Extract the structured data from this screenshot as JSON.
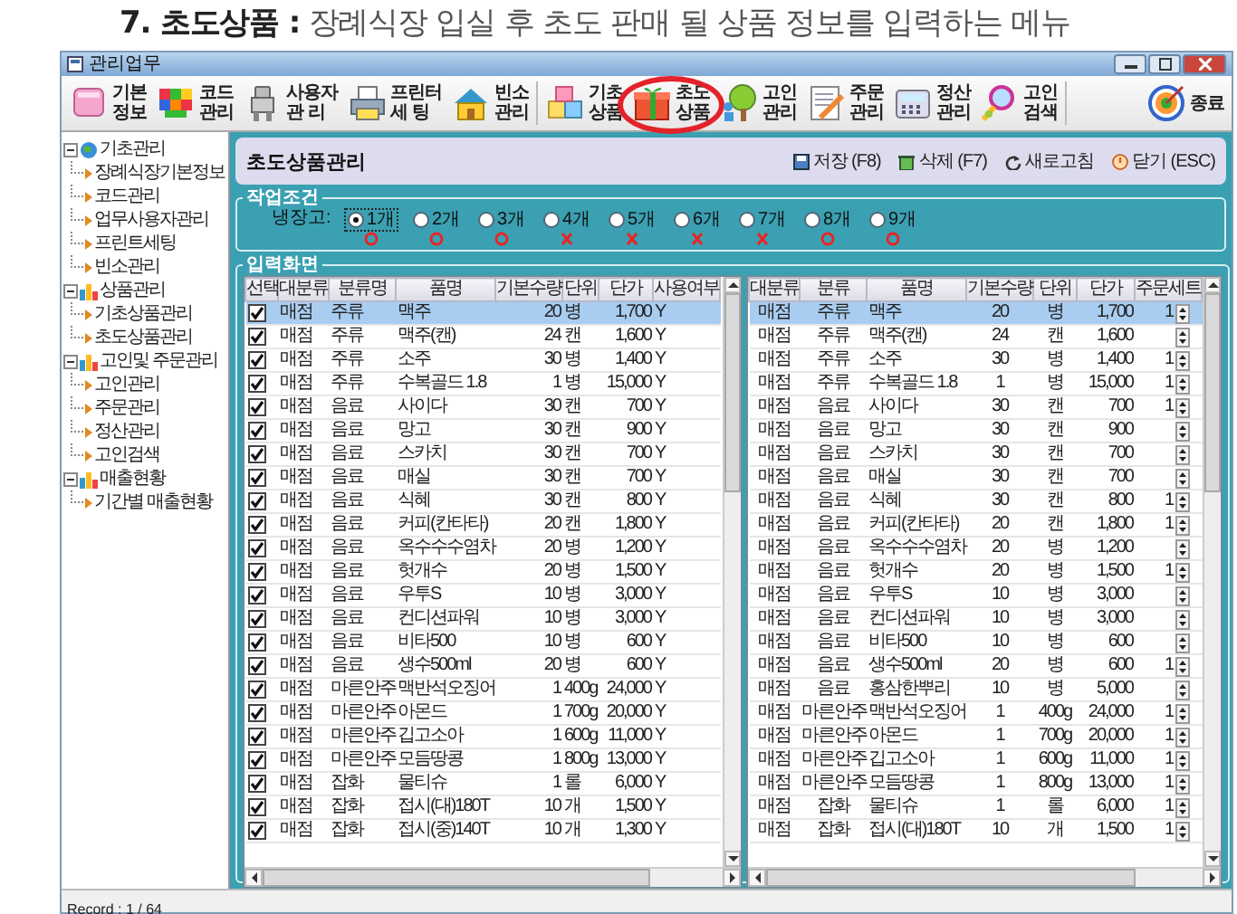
{
  "heading": "**7. 초도상품 :** 장례식장 입실 후 초도 판매 될 상품 정보를 입력하는 메뉴",
  "window": {
    "title": "관리업무"
  },
  "toolbar": [
    {
      "label": "기본\n정보",
      "highlighted": false
    },
    {
      "label": "코드\n관리",
      "highlighted": false
    },
    {
      "label": "사용자\n관 리",
      "highlighted": false
    },
    {
      "label": "프린터\n세 팅",
      "highlighted": false
    },
    {
      "label": "빈소\n관리",
      "highlighted": false
    },
    {
      "label": "기초\n상품",
      "highlighted": false
    },
    {
      "label": "초도\n상품",
      "highlighted": true
    },
    {
      "label": "고인\n관리",
      "highlighted": false
    },
    {
      "label": "주문\n관리",
      "highlighted": false
    },
    {
      "label": "정산\n관리",
      "highlighted": false
    },
    {
      "label": "고인\n검색",
      "highlighted": false
    }
  ],
  "exit_button": "종료",
  "sidebar": {
    "items": [
      {
        "label": "기초관리",
        "expanded": true,
        "children": [
          {
            "label": "장례식장기본정보"
          },
          {
            "label": "코드관리"
          },
          {
            "label": "업무사용자관리"
          },
          {
            "label": "프린트세팅"
          },
          {
            "label": "빈소관리"
          }
        ]
      },
      {
        "label": "상품관리",
        "expanded": true,
        "children": [
          {
            "label": "기초상품관리"
          },
          {
            "label": "초도상품관리"
          }
        ]
      },
      {
        "label": "고인및 주문관리",
        "expanded": true,
        "children": [
          {
            "label": "고인관리"
          },
          {
            "label": "주문관리"
          },
          {
            "label": "정산관리"
          },
          {
            "label": "고인검색"
          }
        ]
      },
      {
        "label": "매출현황",
        "expanded": true,
        "children": [
          {
            "label": "기간별 매출현황"
          }
        ]
      }
    ]
  },
  "panel": {
    "title": "초도상품관리",
    "actions": [
      "저장 (F8)",
      "삭제 (F7)",
      "새로고침",
      "닫기 (ESC)"
    ]
  },
  "conditions": {
    "title": "작업조건",
    "label": "냉장고:",
    "options": [
      {
        "label": "1개",
        "selected": true,
        "available": true
      },
      {
        "label": "2개",
        "selected": false,
        "available": true
      },
      {
        "label": "3개",
        "selected": false,
        "available": true
      },
      {
        "label": "4개",
        "selected": false,
        "available": false
      },
      {
        "label": "5개",
        "selected": false,
        "available": false
      },
      {
        "label": "6개",
        "selected": false,
        "available": false
      },
      {
        "label": "7개",
        "selected": false,
        "available": false
      },
      {
        "label": "8개",
        "selected": false,
        "available": true
      },
      {
        "label": "9개",
        "selected": false,
        "available": true
      }
    ]
  },
  "input": {
    "title": "입력화면",
    "left_table": {
      "columns": [
        "선택",
        "대분류",
        "분류명",
        "품명",
        "기본수량",
        "단위",
        "단가",
        "사용여부"
      ],
      "rows": [
        {
          "selected": true,
          "checked": true,
          "category": "매점",
          "group": "주류",
          "name": "맥주",
          "qty": "20",
          "unit": "병",
          "price": "1,700",
          "use": "Y"
        },
        {
          "selected": false,
          "checked": true,
          "category": "매점",
          "group": "주류",
          "name": "맥주(캔)",
          "qty": "24",
          "unit": "캔",
          "price": "1,600",
          "use": "Y"
        },
        {
          "selected": false,
          "checked": true,
          "category": "매점",
          "group": "주류",
          "name": "소주",
          "qty": "30",
          "unit": "병",
          "price": "1,400",
          "use": "Y"
        },
        {
          "selected": false,
          "checked": true,
          "category": "매점",
          "group": "주류",
          "name": "수복골드 1.8",
          "qty": "1",
          "unit": "병",
          "price": "15,000",
          "use": "Y"
        },
        {
          "selected": false,
          "checked": true,
          "category": "매점",
          "group": "음료",
          "name": "사이다",
          "qty": "30",
          "unit": "캔",
          "price": "700",
          "use": "Y"
        },
        {
          "selected": false,
          "checked": true,
          "category": "매점",
          "group": "음료",
          "name": "망고",
          "qty": "30",
          "unit": "캔",
          "price": "900",
          "use": "Y"
        },
        {
          "selected": false,
          "checked": true,
          "category": "매점",
          "group": "음료",
          "name": "스카치",
          "qty": "30",
          "unit": "캔",
          "price": "700",
          "use": "Y"
        },
        {
          "selected": false,
          "checked": true,
          "category": "매점",
          "group": "음료",
          "name": "매실",
          "qty": "30",
          "unit": "캔",
          "price": "700",
          "use": "Y"
        },
        {
          "selected": false,
          "checked": true,
          "category": "매점",
          "group": "음료",
          "name": "식혜",
          "qty": "30",
          "unit": "캔",
          "price": "800",
          "use": "Y"
        },
        {
          "selected": false,
          "checked": true,
          "category": "매점",
          "group": "음료",
          "name": "커피(칸타타)",
          "qty": "20",
          "unit": "캔",
          "price": "1,800",
          "use": "Y"
        },
        {
          "selected": false,
          "checked": true,
          "category": "매점",
          "group": "음료",
          "name": "옥수수수염차",
          "qty": "20",
          "unit": "병",
          "price": "1,200",
          "use": "Y"
        },
        {
          "selected": false,
          "checked": true,
          "category": "매점",
          "group": "음료",
          "name": "헛개수",
          "qty": "20",
          "unit": "병",
          "price": "1,500",
          "use": "Y"
        },
        {
          "selected": false,
          "checked": true,
          "category": "매점",
          "group": "음료",
          "name": "우투S",
          "qty": "10",
          "unit": "병",
          "price": "3,000",
          "use": "Y"
        },
        {
          "selected": false,
          "checked": true,
          "category": "매점",
          "group": "음료",
          "name": "컨디션파워",
          "qty": "10",
          "unit": "병",
          "price": "3,000",
          "use": "Y"
        },
        {
          "selected": false,
          "checked": true,
          "category": "매점",
          "group": "음료",
          "name": "비타500",
          "qty": "10",
          "unit": "병",
          "price": "600",
          "use": "Y"
        },
        {
          "selected": false,
          "checked": true,
          "category": "매점",
          "group": "음료",
          "name": "생수500ml",
          "qty": "20",
          "unit": "병",
          "price": "600",
          "use": "Y"
        },
        {
          "selected": false,
          "checked": true,
          "category": "매점",
          "group": "마른안주",
          "name": "맥반석오징어",
          "qty": "1",
          "unit": "400g",
          "price": "24,000",
          "use": "Y"
        },
        {
          "selected": false,
          "checked": true,
          "category": "매점",
          "group": "마른안주",
          "name": "아몬드",
          "qty": "1",
          "unit": "700g",
          "price": "20,000",
          "use": "Y"
        },
        {
          "selected": false,
          "checked": true,
          "category": "매점",
          "group": "마른안주",
          "name": "깁고소아",
          "qty": "1",
          "unit": "600g",
          "price": "11,000",
          "use": "Y"
        },
        {
          "selected": false,
          "checked": true,
          "category": "매점",
          "group": "마른안주",
          "name": "모듬땅콩",
          "qty": "1",
          "unit": "800g",
          "price": "13,000",
          "use": "Y"
        },
        {
          "selected": false,
          "checked": true,
          "category": "매점",
          "group": "잡화",
          "name": "물티슈",
          "qty": "1",
          "unit": "롤",
          "price": "6,000",
          "use": "Y"
        },
        {
          "selected": false,
          "checked": true,
          "category": "매점",
          "group": "잡화",
          "name": "접시(대)180T",
          "qty": "10",
          "unit": "개",
          "price": "1,500",
          "use": "Y"
        },
        {
          "selected": false,
          "checked": true,
          "category": "매점",
          "group": "잡화",
          "name": "접시(중)140T",
          "qty": "10",
          "unit": "개",
          "price": "1,300",
          "use": "Y"
        }
      ]
    },
    "right_table": {
      "columns": [
        "대분류",
        "분류",
        "품명",
        "기본수량",
        "단위",
        "단가",
        "주문세트"
      ],
      "rows": [
        {
          "selected": true,
          "category": "매점",
          "group": "주류",
          "name": "맥주",
          "qty": "20",
          "unit": "병",
          "price": "1,700",
          "order_set": "1"
        },
        {
          "selected": false,
          "category": "매점",
          "group": "주류",
          "name": "맥주(캔)",
          "qty": "24",
          "unit": "캔",
          "price": "1,600"
        },
        {
          "selected": false,
          "category": "매점",
          "group": "주류",
          "name": "소주",
          "qty": "30",
          "unit": "병",
          "price": "1,400",
          "order_set": "1"
        },
        {
          "selected": false,
          "category": "매점",
          "group": "주류",
          "name": "수복골드 1.8",
          "qty": "1",
          "unit": "병",
          "price": "15,000",
          "order_set": "1"
        },
        {
          "selected": false,
          "category": "매점",
          "group": "음료",
          "name": "사이다",
          "qty": "30",
          "unit": "캔",
          "price": "700",
          "order_set": "1"
        },
        {
          "selected": false,
          "category": "매점",
          "group": "음료",
          "name": "망고",
          "qty": "30",
          "unit": "캔",
          "price": "900"
        },
        {
          "selected": false,
          "category": "매점",
          "group": "음료",
          "name": "스카치",
          "qty": "30",
          "unit": "캔",
          "price": "700"
        },
        {
          "selected": false,
          "category": "매점",
          "group": "음료",
          "name": "매실",
          "qty": "30",
          "unit": "캔",
          "price": "700"
        },
        {
          "selected": false,
          "category": "매점",
          "group": "음료",
          "name": "식혜",
          "qty": "30",
          "unit": "캔",
          "price": "800",
          "order_set": "1"
        },
        {
          "selected": false,
          "category": "매점",
          "group": "음료",
          "name": "커피(칸타타)",
          "qty": "20",
          "unit": "캔",
          "price": "1,800",
          "order_set": "1"
        },
        {
          "selected": false,
          "category": "매점",
          "group": "음료",
          "name": "옥수수수염차",
          "qty": "20",
          "unit": "병",
          "price": "1,200"
        },
        {
          "selected": false,
          "category": "매점",
          "group": "음료",
          "name": "헛개수",
          "qty": "20",
          "unit": "병",
          "price": "1,500",
          "order_set": "1"
        },
        {
          "selected": false,
          "category": "매점",
          "group": "음료",
          "name": "우투S",
          "qty": "10",
          "unit": "병",
          "price": "3,000"
        },
        {
          "selected": false,
          "category": "매점",
          "group": "음료",
          "name": "컨디션파워",
          "qty": "10",
          "unit": "병",
          "price": "3,000"
        },
        {
          "selected": false,
          "category": "매점",
          "group": "음료",
          "name": "비타500",
          "qty": "10",
          "unit": "병",
          "price": "600"
        },
        {
          "selected": false,
          "category": "매점",
          "group": "음료",
          "name": "생수500ml",
          "qty": "20",
          "unit": "병",
          "price": "600",
          "order_set": "1"
        },
        {
          "selected": false,
          "category": "매점",
          "group": "음료",
          "name": "홍삼한뿌리",
          "qty": "10",
          "unit": "병",
          "price": "5,000"
        },
        {
          "selected": false,
          "category": "매점",
          "group": "마른안주",
          "name": "맥반석오징어",
          "qty": "1",
          "unit": "400g",
          "price": "24,000",
          "order_set": "1"
        },
        {
          "selected": false,
          "category": "매점",
          "group": "마른안주",
          "name": "아몬드",
          "qty": "1",
          "unit": "700g",
          "price": "20,000",
          "order_set": "1"
        },
        {
          "selected": false,
          "category": "매점",
          "group": "마른안주",
          "name": "깁고소아",
          "qty": "1",
          "unit": "600g",
          "price": "11,000",
          "order_set": "1"
        },
        {
          "selected": false,
          "category": "매점",
          "group": "마른안주",
          "name": "모듬땅콩",
          "qty": "1",
          "unit": "800g",
          "price": "13,000",
          "order_set": "1"
        },
        {
          "selected": false,
          "category": "매점",
          "group": "잡화",
          "name": "물티슈",
          "qty": "1",
          "unit": "롤",
          "price": "6,000",
          "order_set": "1"
        },
        {
          "selected": false,
          "category": "매점",
          "group": "잡화",
          "name": "접시(대)180T",
          "qty": "10",
          "unit": "개",
          "price": "1,500",
          "order_set": "1"
        }
      ]
    }
  },
  "status_bar": "Record : 1 / 64"
}
